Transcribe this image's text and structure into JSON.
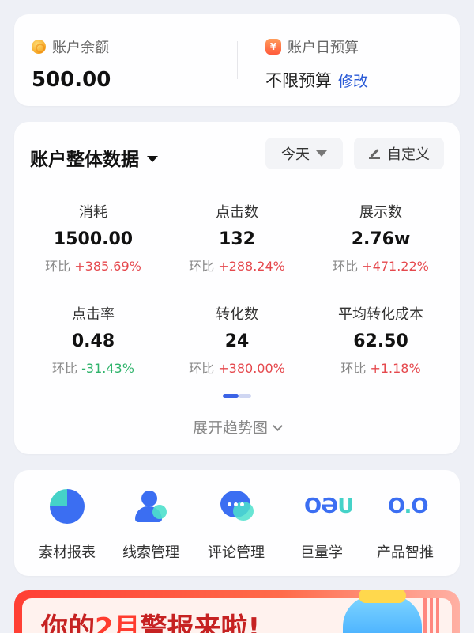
{
  "account": {
    "balance_label": "账户余额",
    "balance_value": "500.00",
    "budget_label": "账户日预算",
    "budget_value": "不限预算",
    "budget_edit": "修改",
    "icons": {
      "balance": "coin-icon",
      "budget": "yen-badge-icon"
    }
  },
  "overview": {
    "title": "账户整体数据",
    "range_label": "今天",
    "custom_label": "自定义",
    "metrics": [
      {
        "name": "消耗",
        "value": "1500.00",
        "cmp_label": "环比",
        "cmp_value": "+385.69%",
        "trend": "up"
      },
      {
        "name": "点击数",
        "value": "132",
        "cmp_label": "环比",
        "cmp_value": "+288.24%",
        "trend": "up"
      },
      {
        "name": "展示数",
        "value": "2.76w",
        "cmp_label": "环比",
        "cmp_value": "+471.22%",
        "trend": "up"
      },
      {
        "name": "点击率",
        "value": "0.48",
        "cmp_label": "环比",
        "cmp_value": "-31.43%",
        "trend": "down"
      },
      {
        "name": "转化数",
        "value": "24",
        "cmp_label": "环比",
        "cmp_value": "+380.00%",
        "trend": "up"
      },
      {
        "name": "平均转化成本",
        "value": "62.50",
        "cmp_label": "环比",
        "cmp_value": "+1.18%",
        "trend": "up"
      }
    ],
    "expand_label": "展开趋势图",
    "colors": {
      "up": "#e5484d",
      "down": "#2fb36b",
      "accent": "#2b5bd7"
    }
  },
  "tools": [
    {
      "label": "素材报表",
      "icon": "pie-chart-icon"
    },
    {
      "label": "线索管理",
      "icon": "user-search-icon"
    },
    {
      "label": "评论管理",
      "icon": "chat-bubble-icon"
    },
    {
      "label": "巨量学",
      "icon": "oceanengine-learn-logo"
    },
    {
      "label": "产品智推",
      "icon": "product-recommend-logo"
    }
  ],
  "banner": {
    "text_prefix": "你的",
    "text_highlight": "2月",
    "text_suffix": "警报来啦!"
  }
}
